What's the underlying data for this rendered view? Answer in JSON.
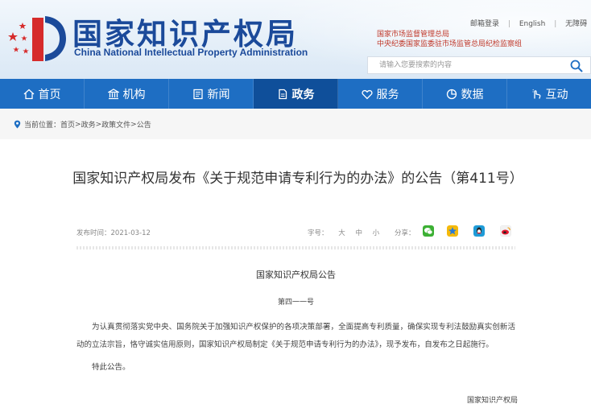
{
  "header": {
    "logo_cn": "国家知识产权局",
    "logo_en": "China National Intellectual Property Administration",
    "top_links": [
      "邮箱登录",
      "English",
      "无障碍"
    ],
    "org_line1": "国家市场监督管理总局",
    "org_line2": "中央纪委国家监委驻市场监管总局纪检监察组",
    "search_placeholder": "请输入您要搜索的内容"
  },
  "nav": {
    "items": [
      {
        "label": "首页",
        "icon": "home-icon"
      },
      {
        "label": "机构",
        "icon": "institution-icon"
      },
      {
        "label": "新闻",
        "icon": "news-icon"
      },
      {
        "label": "政务",
        "icon": "document-icon",
        "active": true
      },
      {
        "label": "服务",
        "icon": "service-icon"
      },
      {
        "label": "数据",
        "icon": "pie-chart-icon"
      },
      {
        "label": "互动",
        "icon": "interact-icon"
      }
    ]
  },
  "breadcrumb": {
    "prefix": "当前位置：",
    "items": [
      "首页",
      "政务",
      "政策文件",
      "公告"
    ],
    "separator": ">"
  },
  "article": {
    "title": "国家知识产权局发布《关于规范申请专利行为的办法》的公告（第411号）",
    "date_label": "发布时间：",
    "date": "2021-03-12",
    "font_size_label": "字号：",
    "font_sizes": [
      "大",
      "中",
      "小"
    ],
    "share_label": "分享：",
    "share_icons": [
      "wechat-icon",
      "qzone-icon",
      "qq-icon",
      "weibo-icon"
    ],
    "doc_heading": "国家知识产权局公告",
    "doc_number": "第四一一号",
    "paragraph": "为认真贯彻落实党中央、国务院关于加强知识产权保护的各项决策部署，全面提高专利质量，确保实现专利法鼓励真实创新活动的立法宗旨，恪守诚实信用原则，国家知识产权局制定《关于规范申请专利行为的办法》，现予发布，自发布之日起施行。",
    "closing": "特此公告。",
    "signature": "国家知识产权局"
  },
  "colors": {
    "brand_blue": "#1b4a9a",
    "nav_blue": "#1e6ec3",
    "nav_active": "#0f4f9a",
    "org_red": "#c0392b"
  }
}
